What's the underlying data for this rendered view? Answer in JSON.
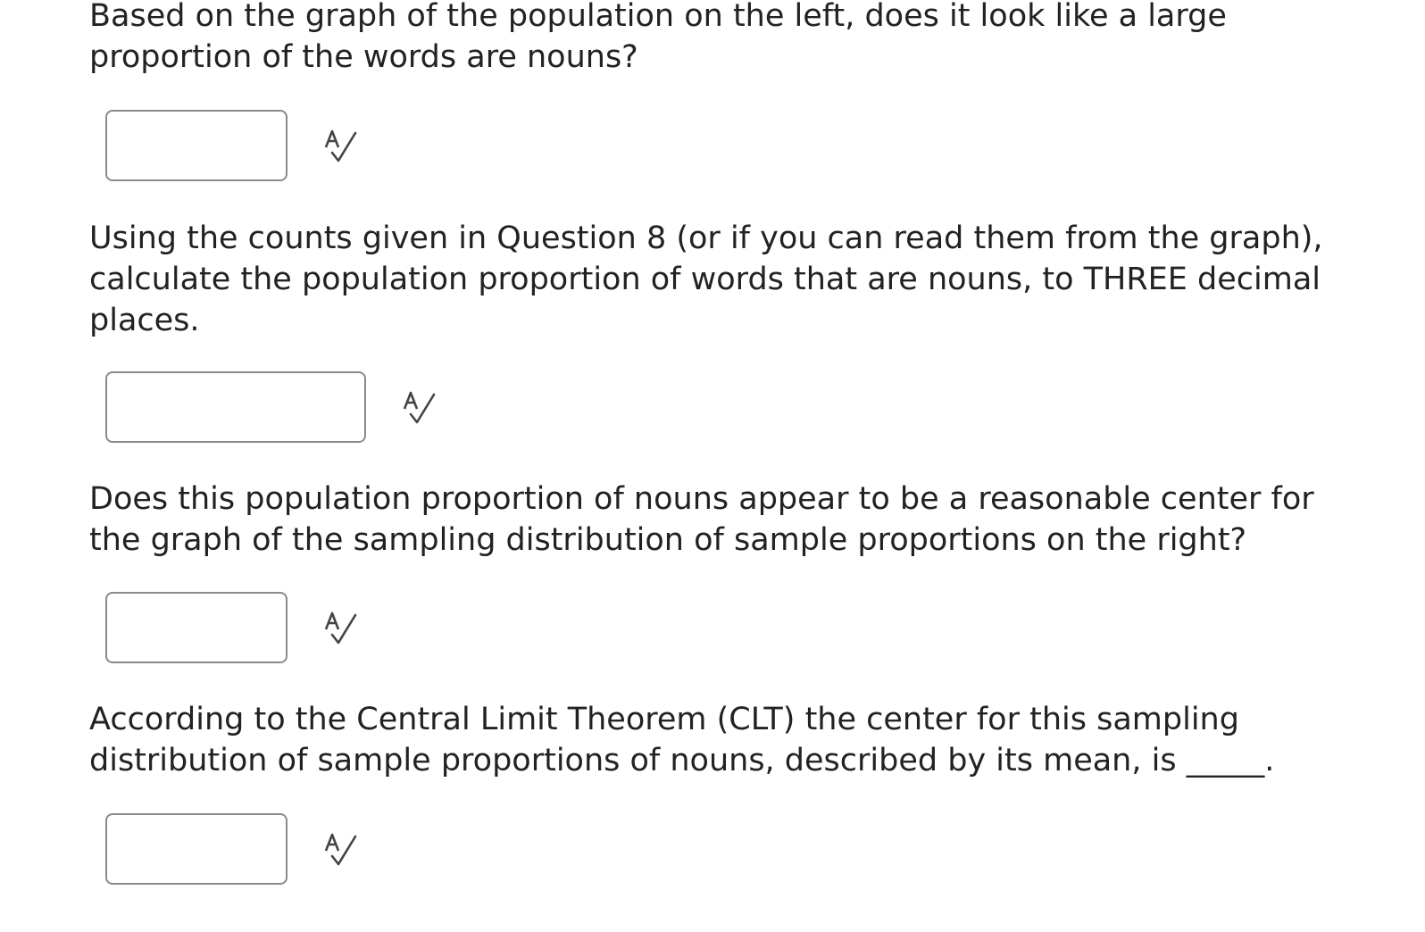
{
  "questions": [
    {
      "text": "Based on the graph of the population on the left, does it look like a large proportion of the words are nouns?",
      "answer_value": "",
      "spellcheck_icon": "spellcheck-icon"
    },
    {
      "text": "Using the counts given in Question 8 (or if you can read them from the graph), calculate the population proportion of words that are nouns, to THREE decimal places.",
      "answer_value": "",
      "spellcheck_icon": "spellcheck-icon"
    },
    {
      "text": "Does this population proportion of nouns appear to be a reasonable center for the graph of the sampling distribution of sample proportions on the right?",
      "answer_value": "",
      "spellcheck_icon": "spellcheck-icon"
    },
    {
      "text": "According to the Central Limit Theorem (CLT) the center for this sampling distribution of sample proportions of nouns, described by its mean, is _____.",
      "answer_value": "",
      "spellcheck_icon": "spellcheck-icon"
    }
  ]
}
